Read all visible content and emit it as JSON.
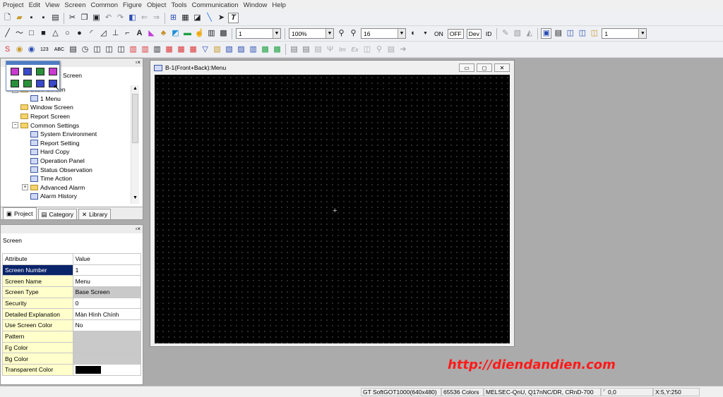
{
  "menubar": {
    "items": [
      "Project",
      "Edit",
      "View",
      "Screen",
      "Common",
      "Figure",
      "Object",
      "Tools",
      "Communication",
      "Window",
      "Help"
    ]
  },
  "toolbar2": {
    "line_width_value": "1",
    "zoom_value": "100%",
    "font_size_value": "16",
    "on_label": "ON",
    "off_label": "OFF",
    "dev_label": "Dev",
    "id_label": "ID",
    "right_combo_value": "1"
  },
  "toolbar3": {
    "abc_label": "ABC",
    "num_label": "123",
    "im_label": "Im",
    "ex_label": "Ex"
  },
  "project_panel": {
    "header_partial": "Screen",
    "tree": [
      {
        "label": "Base Screen",
        "indent": 1,
        "type": "folder",
        "expander": "−"
      },
      {
        "label": "1 Menu",
        "indent": 2,
        "type": "doc",
        "expander": ""
      },
      {
        "label": "Window Screen",
        "indent": 1,
        "type": "folder",
        "expander": ""
      },
      {
        "label": "Report Screen",
        "indent": 1,
        "type": "folder",
        "expander": ""
      },
      {
        "label": "Common Settings",
        "indent": 1,
        "type": "folder",
        "expander": "−"
      },
      {
        "label": "System Environment",
        "indent": 2,
        "type": "doc",
        "expander": ""
      },
      {
        "label": "Report Setting",
        "indent": 2,
        "type": "doc",
        "expander": ""
      },
      {
        "label": "Hard Copy",
        "indent": 2,
        "type": "doc",
        "expander": ""
      },
      {
        "label": "Operation Panel",
        "indent": 2,
        "type": "doc",
        "expander": ""
      },
      {
        "label": "Status Observation",
        "indent": 2,
        "type": "doc",
        "expander": ""
      },
      {
        "label": "Time Action",
        "indent": 2,
        "type": "doc",
        "expander": ""
      },
      {
        "label": "Advanced Alarm",
        "indent": 2,
        "type": "folder",
        "expander": "+"
      },
      {
        "label": "Alarm History",
        "indent": 2,
        "type": "doc",
        "expander": ""
      }
    ],
    "tabs": [
      "Project",
      "Category",
      "Library"
    ]
  },
  "property_panel": {
    "caption": "Screen",
    "header": {
      "attribute": "Attribute",
      "value": "Value"
    },
    "rows": [
      {
        "attribute": "Screen Number",
        "value": "1"
      },
      {
        "attribute": "Screen Name",
        "value": "Menu"
      },
      {
        "attribute": "Screen Type",
        "value": "Base Screen"
      },
      {
        "attribute": "Security",
        "value": "0"
      },
      {
        "attribute": "Detailed Explanation",
        "value": "Màn Hình Chính"
      },
      {
        "attribute": "Use Screen Color",
        "value": "No"
      },
      {
        "attribute": "Pattern",
        "value": ""
      },
      {
        "attribute": "Fg Color",
        "value": ""
      },
      {
        "attribute": "Bg Color",
        "value": ""
      },
      {
        "attribute": "Transparent Color",
        "value": ""
      }
    ],
    "transparent_color_swatch": "#000000"
  },
  "screen_window": {
    "title": "B-1(Front+Back):Menu",
    "canvas_color": "#000000"
  },
  "watermark": "http://diendandien.com",
  "statusbar": {
    "device": "GT SoftGOT1000(640x480)",
    "colors": "65536 Colors",
    "plc": "MELSEC-QnU, Q17nNC/DR, CRnD-700",
    "origin": "0,0",
    "cursor": "X:5,Y:250"
  }
}
